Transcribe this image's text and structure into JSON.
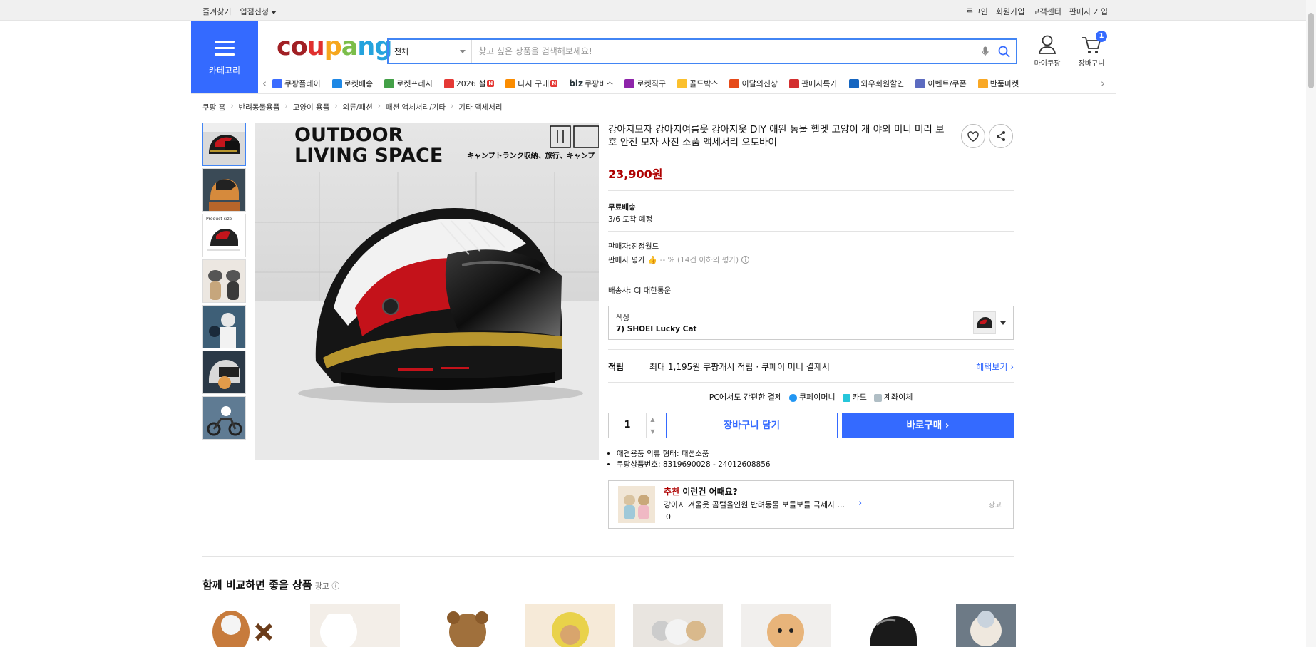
{
  "topbar": {
    "left": [
      "즐겨찾기",
      "입점신청"
    ],
    "right": [
      "로그인",
      "회원가입",
      "고객센터",
      "판매자 가입"
    ]
  },
  "header": {
    "category_label": "카테고리",
    "logo_text": "coupang",
    "logo_colors": [
      "#a12025",
      "#a12025",
      "#e0302e",
      "#f6a71d",
      "#7bbd4a",
      "#25a3dd",
      "#25a3dd"
    ],
    "search_category": "전체",
    "search_placeholder": "찾고 싶은 상품을 검색해보세요!",
    "mypage_label": "마이쿠팡",
    "cart_label": "장바구니",
    "cart_count": "1"
  },
  "nav": [
    {
      "label": "쿠팡플레이",
      "color": "#3b6cff"
    },
    {
      "label": "로켓배송",
      "color": "#1e88e5"
    },
    {
      "label": "로켓프레시",
      "color": "#43a047"
    },
    {
      "label": "2026 설",
      "color": "#e53935",
      "badge": "N"
    },
    {
      "label": "다시 구매",
      "color": "#fb8c00",
      "badge": "N"
    },
    {
      "label": "쿠팡비즈",
      "color": "#263238",
      "prefix": "biz"
    },
    {
      "label": "로켓직구",
      "color": "#8e24aa"
    },
    {
      "label": "골드박스",
      "color": "#fbc02d"
    },
    {
      "label": "이달의신상",
      "color": "#e64a19"
    },
    {
      "label": "판매자특가",
      "color": "#d32f2f"
    },
    {
      "label": "와우회원할인",
      "color": "#1565c0"
    },
    {
      "label": "이벤트/쿠폰",
      "color": "#5c6bc0"
    },
    {
      "label": "반품마켓",
      "color": "#f9a825"
    }
  ],
  "breadcrumb": [
    "쿠팡 홈",
    "반려동물용품",
    "고양이 용품",
    "의류/패션",
    "패션 액세서리/기타",
    "기타 액세서리"
  ],
  "product": {
    "title": "강아지모자 강아지여름옷 강아지옷 DIY 애완 동물 헬멧 고양이 개 야외 미니 머리 보호 안전 모자 사진 소품 액세서리 오토바이",
    "price": "23,900원",
    "image_banner_line1": "OUTDOOR",
    "image_banner_line2": "LIVING SPACE",
    "image_banner_jp": "キャンプトランク収納、旅行、キャンプ",
    "thumb3_label": "Product size",
    "shipping_title": "무료배송",
    "shipping_date": "3/6 도착 예정",
    "seller": "판매자:진정월드",
    "seller_rating_label": "판매자 평가",
    "seller_rating_value": "-- % (14건 이하의 평가)",
    "carrier": "배송사:  CJ 대한통운",
    "option_label": "색상",
    "option_value": "7) SHOEI Lucky Cat",
    "reward_key": "적립",
    "reward_text_1": "최대 1,195원",
    "reward_link_text": "쿠팡캐시 적립",
    "reward_text_2": "· 쿠페이 머니 결제시",
    "reward_more": "헤택보기 ›",
    "pay_title": "PC에서도 간편한 결제",
    "pay_methods": [
      "쿠페이머니",
      "카드",
      "계좌이체"
    ],
    "quantity": "1",
    "cart_button": "장바구니 담기",
    "buy_button": "바로구매 ›",
    "bullets": [
      "애견용품 의류 형태: 패션소품",
      "쿠팡상품번호: 8319690028 - 24012608856"
    ]
  },
  "recommend": {
    "title_accent": "추천",
    "title_rest": " 이런건 어때요?",
    "item": "강아지 겨울옷 곰털올인원 반려동물 보들보들 극세사 ...",
    "count": "0",
    "ad": "광고"
  },
  "compare": {
    "title": "함께 비교하면 좋을 상품",
    "ad": "광고 ⓘ"
  }
}
